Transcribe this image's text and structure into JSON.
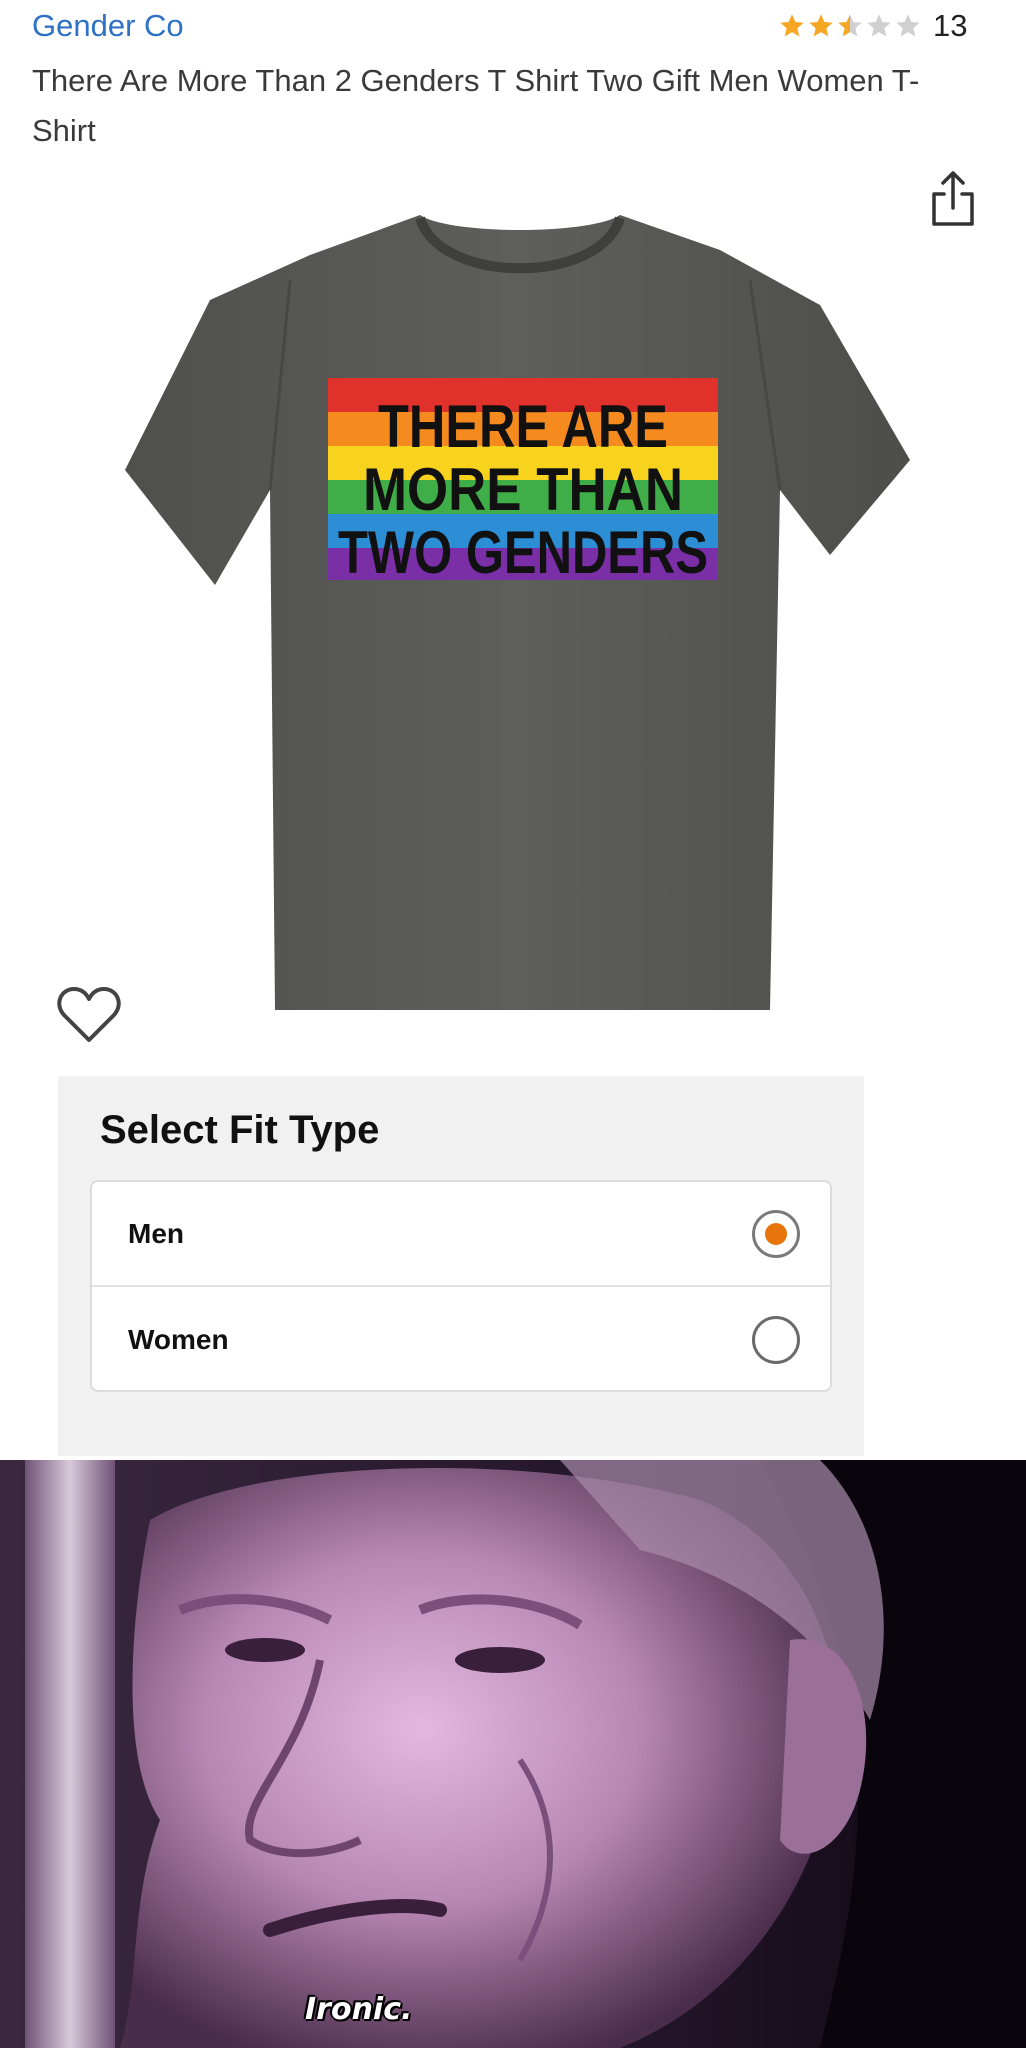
{
  "product": {
    "brand": "Gender Co",
    "title": "There Are More Than 2 Genders T Shirt Two Gift Men Women T-Shirt",
    "rating": 2.5,
    "rating_max": 5,
    "review_count": "13",
    "share_icon": "share-icon",
    "wishlist_icon": "heart-icon"
  },
  "shirt_print": {
    "line1": "THERE ARE",
    "line2": "MORE THAN",
    "line3": "TWO GENDERS"
  },
  "fit_selector": {
    "heading": "Select Fit Type",
    "options": [
      {
        "label": "Men",
        "selected": true
      },
      {
        "label": "Women",
        "selected": false
      }
    ]
  },
  "meme": {
    "caption": "Ironic."
  },
  "colors": {
    "brand_link": "#2f72c4",
    "star_filled": "#f5a623",
    "star_empty": "#d0d0d0",
    "radio_selected": "#e8740c",
    "shirt": "#5b5b58",
    "rainbow": [
      "#e0312b",
      "#f58a1f",
      "#f7d31e",
      "#3fae49",
      "#2c8fd6",
      "#7a2fa6"
    ]
  }
}
